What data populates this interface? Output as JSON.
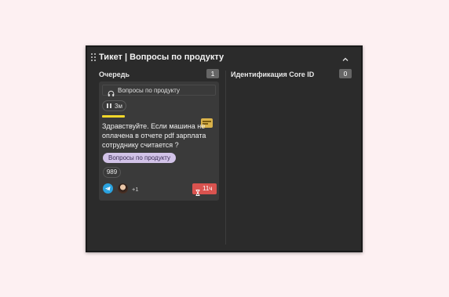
{
  "widget": {
    "title": "Тикет | Вопросы по продукту",
    "icons": {
      "drag": "drag-handle-icon",
      "collapse": "chevron-up-icon"
    }
  },
  "columns": [
    {
      "name": "Очередь",
      "count": "1"
    },
    {
      "name": "Идентификация Core ID",
      "count": "0"
    }
  ],
  "card": {
    "topic": "Вопросы по продукту",
    "timer": "3м",
    "message": "Здравствуйте. Если машина не оплачена в отчете pdf зарплата сотруднику считается ?",
    "tag": "Вопросы по продукту",
    "number": "989",
    "extra_participants": "+1",
    "sla": "11ч",
    "colors": {
      "progress": "#f2d72a",
      "tag": "#d2c3e8",
      "sla": "#d9534f",
      "channel": "#2aa3e0"
    },
    "icons": {
      "topic": "headset-icon",
      "timer": "pause-icon",
      "channel": "telegram-icon",
      "sla": "hourglass-icon",
      "attachment": "card-icon"
    }
  }
}
